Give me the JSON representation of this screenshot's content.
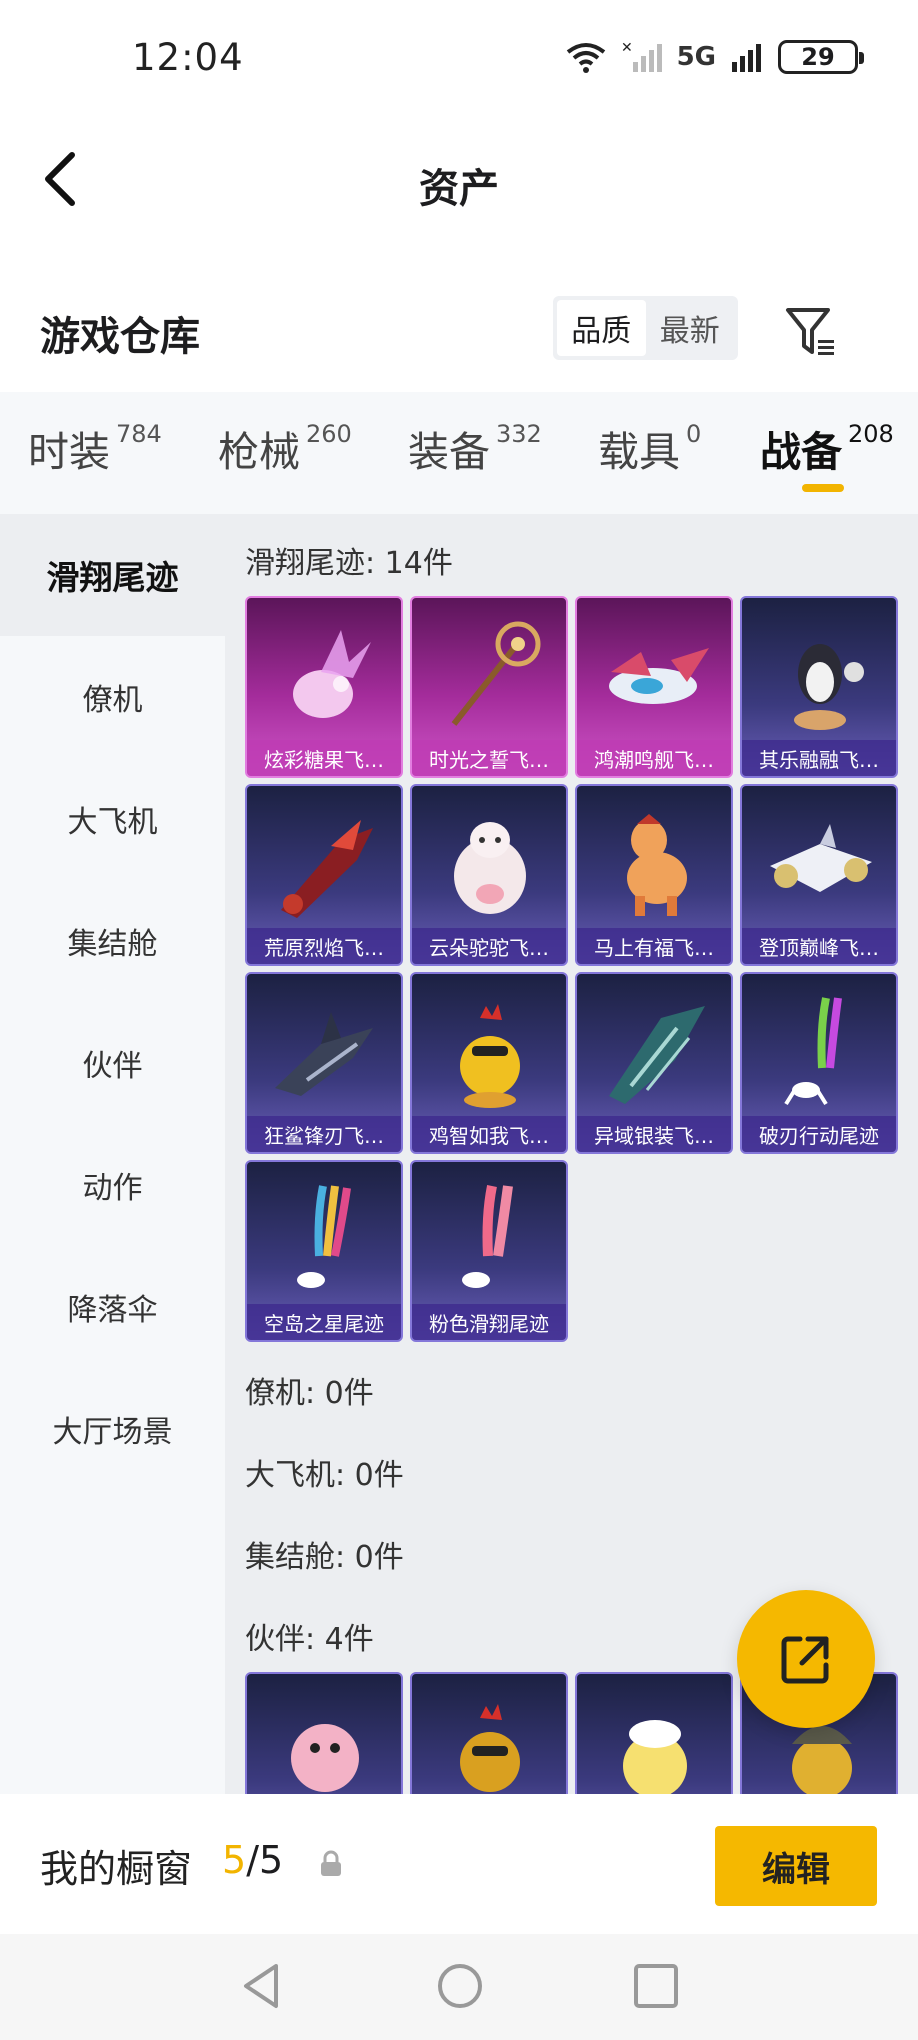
{
  "status_bar": {
    "time": "12:04",
    "network": "5G",
    "battery": "29"
  },
  "header": {
    "title": "资产"
  },
  "section": {
    "title": "游戏仓库",
    "sort_options": [
      "品质",
      "最新"
    ],
    "sort_active": "品质"
  },
  "categories": [
    {
      "label": "时装",
      "count": "784"
    },
    {
      "label": "枪械",
      "count": "260"
    },
    {
      "label": "装备",
      "count": "332"
    },
    {
      "label": "载具",
      "count": "0"
    },
    {
      "label": "战备",
      "count": "208"
    }
  ],
  "sidebar": {
    "items": [
      "滑翔尾迹",
      "僚机",
      "大飞机",
      "集结舱",
      "伙伴",
      "动作",
      "降落伞",
      "大厅场景"
    ]
  },
  "groups": {
    "glide": {
      "title": "滑翔尾迹: 14件",
      "items": [
        "炫彩糖果飞…",
        "时光之誓飞…",
        "鸿潮鸣舰飞…",
        "其乐融融飞…",
        "荒原烈焰飞…",
        "云朵驼驼飞…",
        "马上有福飞…",
        "登顶巅峰飞…",
        "狂鲨锋刃飞…",
        "鸡智如我飞…",
        "异域银装飞…",
        "破刃行动尾迹",
        "空岛之星尾迹",
        "粉色滑翔尾迹"
      ]
    },
    "wingman": {
      "title": "僚机: 0件"
    },
    "bigplane": {
      "title": "大飞机: 0件"
    },
    "capsule": {
      "title": "集结舱: 0件"
    },
    "partner": {
      "title": "伙伴: 4件"
    }
  },
  "showcase": {
    "label": "我的橱窗",
    "current": "5",
    "separator": "/",
    "total": "5",
    "edit_label": "编辑"
  },
  "colors": {
    "accent": "#f5b800",
    "rare_pink": "#a42c9b",
    "rare_purple": "#3b3a7e"
  }
}
